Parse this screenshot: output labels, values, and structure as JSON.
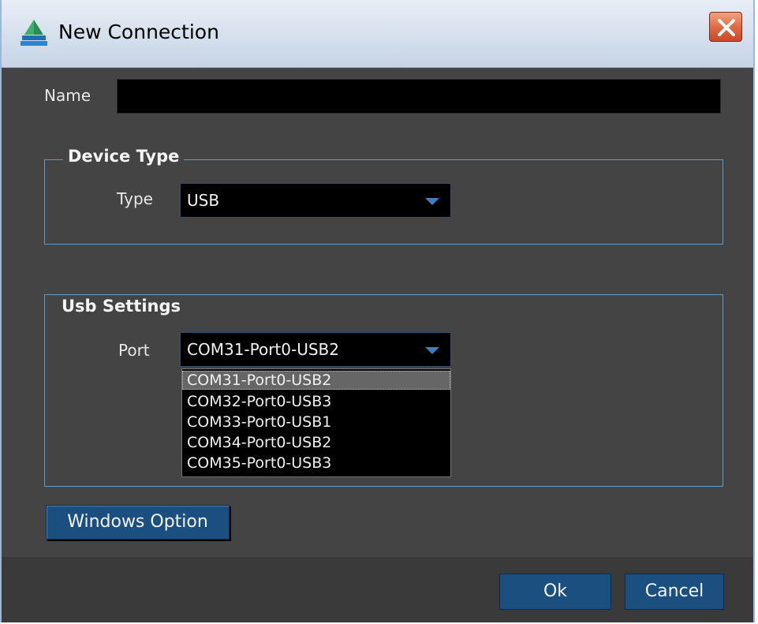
{
  "window": {
    "title": "New Connection",
    "icon": "ship-app-icon",
    "close_icon": "close-icon"
  },
  "name_field": {
    "label": "Name",
    "value": ""
  },
  "device_type": {
    "group_title": "Device Type",
    "type_label": "Type",
    "type_value": "USB"
  },
  "usb_settings": {
    "group_title": "Usb Settings",
    "port_label": "Port",
    "port_value": "COM31-Port0-USB2",
    "port_options": [
      "COM31-Port0-USB2",
      "COM32-Port0-USB3",
      "COM33-Port0-USB1",
      "COM34-Port0-USB2",
      "COM35-Port0-USB3"
    ],
    "selected_index": 0
  },
  "buttons": {
    "windows_option": "Windows Option",
    "ok": "Ok",
    "cancel": "Cancel"
  },
  "colors": {
    "background": "#444444",
    "accent": "#1a4f80",
    "group_border": "#5d9ac8"
  }
}
